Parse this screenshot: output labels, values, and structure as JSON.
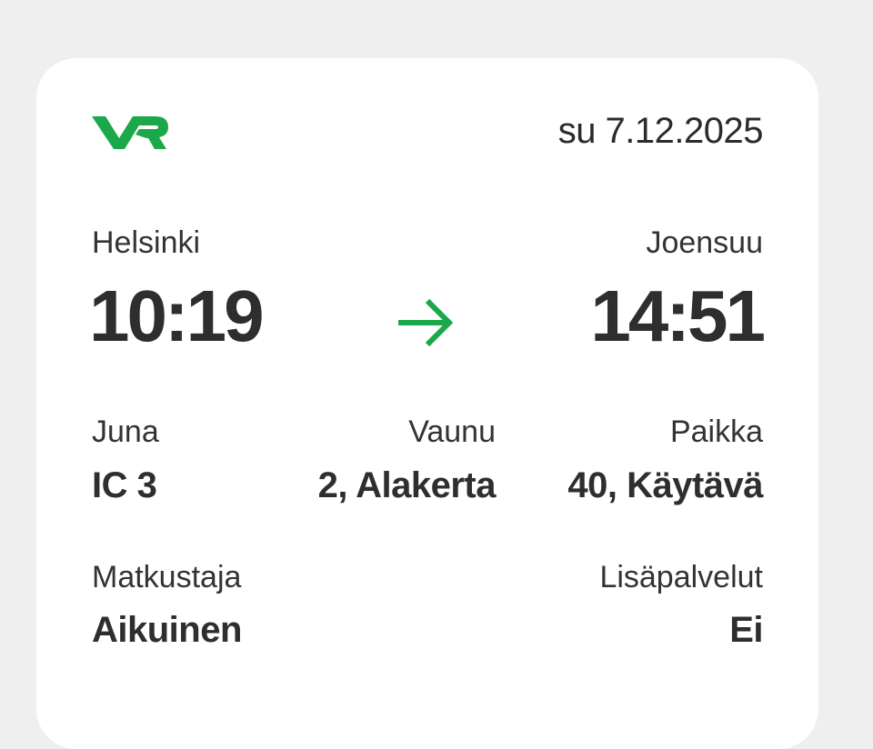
{
  "header": {
    "date": "su 7.12.2025"
  },
  "colors": {
    "brand": "#1aa84a",
    "text": "#2b2b2b",
    "card": "#ffffff",
    "background": "#efefef"
  },
  "journey": {
    "origin": {
      "station": "Helsinki",
      "time": "10:19"
    },
    "destination": {
      "station": "Joensuu",
      "time": "14:51"
    }
  },
  "details": {
    "train": {
      "label": "Juna",
      "value": "IC 3"
    },
    "car": {
      "label": "Vaunu",
      "value": "2, Alakerta"
    },
    "seat": {
      "label": "Paikka",
      "value": "40, Käytävä"
    },
    "passenger": {
      "label": "Matkustaja",
      "value": "Aikuinen"
    },
    "extras": {
      "label": "Lisäpalvelut",
      "value": "Ei"
    }
  },
  "icons": {
    "logo": "vr-logo",
    "direction": "arrow-right-icon"
  }
}
